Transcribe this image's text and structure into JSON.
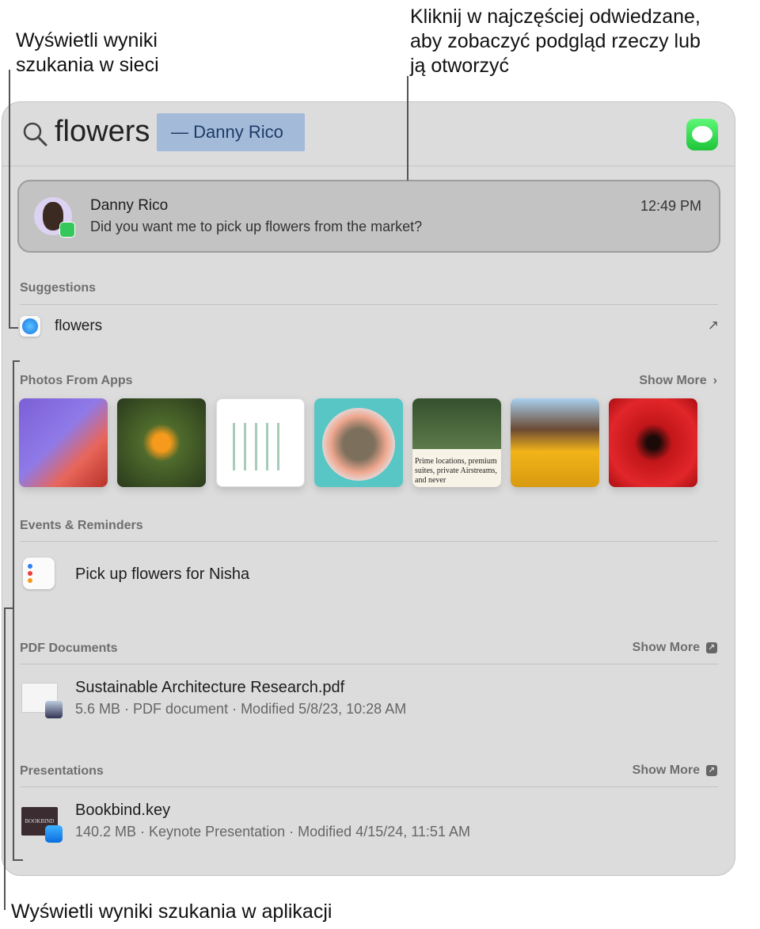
{
  "callouts": {
    "web_results": [
      "Wyświetli wyniki",
      "szukania w sieci"
    ],
    "top_hit": [
      "Kliknij w najczęściej odwiedzane,",
      "aby zobaczyć podgląd rzeczy lub",
      "ją otworzyć"
    ],
    "app_results": "Wyświetli wyniki szukania w aplikacji"
  },
  "search": {
    "query": "flowers",
    "completion": "— Danny Rico",
    "icon": "search-icon",
    "app_icon": "messages-icon"
  },
  "top_hit": {
    "name": "Danny Rico",
    "time": "12:49 PM",
    "message": "Did you want me to pick up flowers from the market?"
  },
  "suggestions": {
    "header": "Suggestions",
    "items": [
      {
        "label": "flowers",
        "icon": "safari-icon"
      }
    ]
  },
  "photos": {
    "header": "Photos From Apps",
    "show_more": "Show More"
  },
  "events": {
    "header": "Events & Reminders",
    "items": [
      {
        "title": "Pick up flowers for Nisha",
        "icon": "reminders-icon"
      }
    ]
  },
  "pdf": {
    "header": "PDF Documents",
    "show_more": "Show More",
    "items": [
      {
        "title": "Sustainable Architecture Research.pdf",
        "meta": "5.6 MB · PDF document · Modified 5/8/23, 10:28 AM"
      }
    ]
  },
  "presentations": {
    "header": "Presentations",
    "show_more": "Show More",
    "items": [
      {
        "title": "Bookbind.key",
        "meta": "140.2 MB · Keynote Presentation · Modified 4/15/24, 11:51 AM",
        "thumb_text": "BOOKBIND"
      }
    ]
  },
  "thumb5_text": "Prime locations, premium suites, private Airstreams, and never",
  "colors": {
    "panel": "#dcdcdc",
    "selection": "#a3bbd9",
    "messages_green": "#34c759"
  }
}
